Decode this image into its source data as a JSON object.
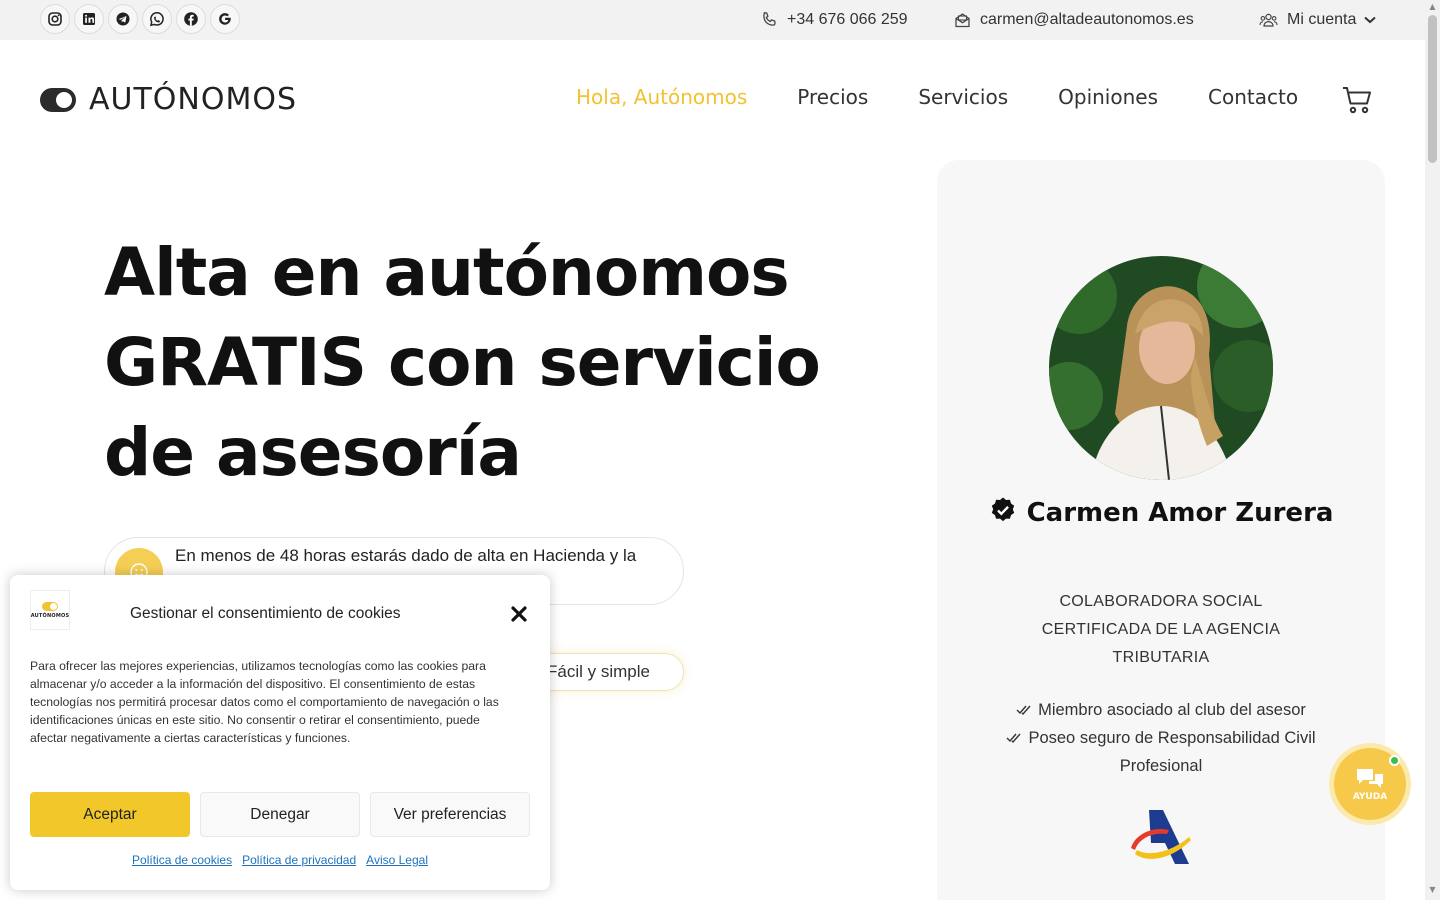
{
  "topbar": {
    "social": [
      "instagram-icon",
      "linkedin-icon",
      "telegram-icon",
      "whatsapp-icon",
      "facebook-icon",
      "google-icon"
    ],
    "phone": "+34 676 066 259",
    "email": "carmen@altadeautonomos.es",
    "account": "Mi cuenta"
  },
  "header": {
    "logo_text": "AUTÓNOMOS",
    "nav": [
      {
        "label": "Hola, Autónomos",
        "active": true
      },
      {
        "label": "Precios"
      },
      {
        "label": "Servicios"
      },
      {
        "label": "Opiniones"
      },
      {
        "label": "Contacto"
      }
    ],
    "accent_color": "#f1c232"
  },
  "hero": {
    "title": "Alta en autónomos GRATIS con servicio de asesoría",
    "note": "En menos de 48 horas estarás dado de alta en Hacienda y la",
    "pill": "Fácil y simple"
  },
  "profile": {
    "name": "Carmen Amor Zurera",
    "role": "COLABORADORA SOCIAL CERTIFICADA DE LA AGENCIA TRIBUTARIA",
    "features": [
      "Miembro asociado al club del asesor",
      "Poseo seguro de Responsabilidad Civil Profesional"
    ]
  },
  "help": {
    "label": "AYUDA"
  },
  "cookie": {
    "logo_word": "AUTÓNOMOS",
    "title": "Gestionar el consentimiento de cookies",
    "body": "Para ofrecer las mejores experiencias, utilizamos tecnologías como las cookies para almacenar y/o acceder a la información del dispositivo. El consentimiento de estas tecnologías nos permitirá procesar datos como el comportamiento de navegación o las identificaciones únicas en este sitio. No consentir o retirar el consentimiento, puede afectar negativamente a ciertas características y funciones.",
    "accept": "Aceptar",
    "deny": "Denegar",
    "preferences": "Ver preferencias",
    "links": [
      "Política de cookies",
      "Política de privacidad",
      "Aviso Legal"
    ],
    "accept_color": "#f1c72a"
  }
}
